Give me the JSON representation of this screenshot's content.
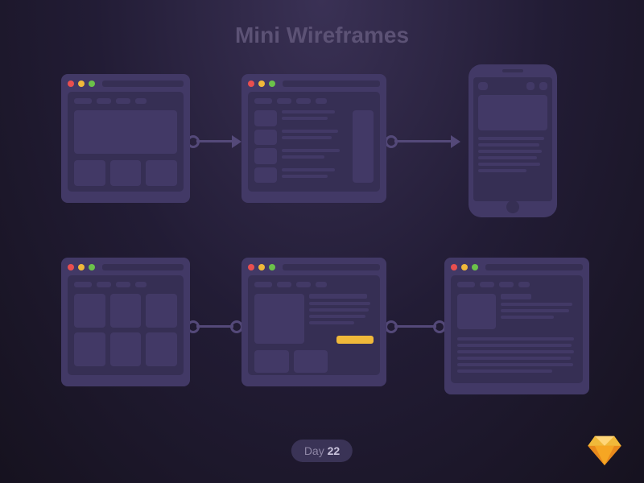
{
  "title": "Mini Wireframes",
  "badge": {
    "label": "Day",
    "number": "22"
  },
  "icons": {
    "sketch": "sketch-diamond-icon"
  },
  "colors": {
    "bg_dark": "#16121f",
    "bg_mid": "#3a3155",
    "window": "#423966",
    "panel": "#362f54",
    "connector": "#544979",
    "accent": "#f0b93a",
    "dot_red": "#e94f4f",
    "dot_yellow": "#f0b93a",
    "dot_green": "#6bc24a"
  },
  "flow": {
    "row1": [
      {
        "id": "wf-hero",
        "type": "browser",
        "layout": "hero + 3 cards"
      },
      {
        "id": "wf-article-sidebar",
        "type": "browser",
        "layout": "thumb list + text + sidebar"
      },
      {
        "id": "wf-mobile",
        "type": "phone",
        "layout": "image + text lines"
      }
    ],
    "row2": [
      {
        "id": "wf-grid",
        "type": "browser",
        "layout": "3x2 grid"
      },
      {
        "id": "wf-post",
        "type": "browser",
        "layout": "image + text + cta + thumbs"
      },
      {
        "id": "wf-blog",
        "type": "browser",
        "layout": "thumb + heading + paragraph lines"
      }
    ],
    "connectors": [
      {
        "from": "wf-hero",
        "to": "wf-article-sidebar",
        "style": "arrow"
      },
      {
        "from": "wf-article-sidebar",
        "to": "wf-mobile",
        "style": "arrow"
      },
      {
        "from": "wf-grid",
        "to": "wf-post",
        "style": "dot"
      },
      {
        "from": "wf-post",
        "to": "wf-blog",
        "style": "dot"
      }
    ]
  }
}
